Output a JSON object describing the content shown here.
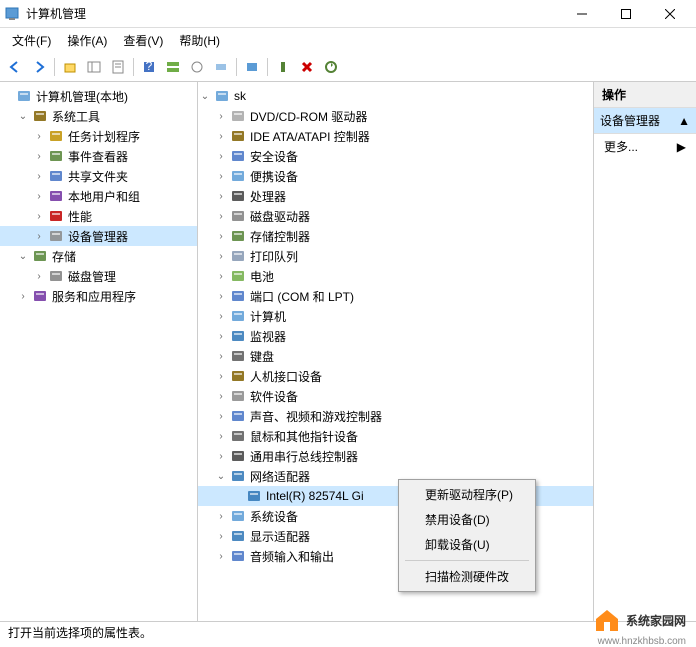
{
  "window": {
    "title": "计算机管理"
  },
  "menubar": [
    "文件(F)",
    "操作(A)",
    "查看(V)",
    "帮助(H)"
  ],
  "actions_panel": {
    "header": "操作",
    "selected": "设备管理器",
    "more": "更多..."
  },
  "statusbar": "打开当前选择项的属性表。",
  "left_tree": {
    "root": "计算机管理(本地)",
    "groups": [
      {
        "label": "系统工具",
        "expanded": true,
        "children": [
          {
            "label": "任务计划程序",
            "icon": "task"
          },
          {
            "label": "事件查看器",
            "icon": "event"
          },
          {
            "label": "共享文件夹",
            "icon": "share"
          },
          {
            "label": "本地用户和组",
            "icon": "users"
          },
          {
            "label": "性能",
            "icon": "perf"
          },
          {
            "label": "设备管理器",
            "icon": "device",
            "selected": true
          }
        ]
      },
      {
        "label": "存储",
        "expanded": true,
        "children": [
          {
            "label": "磁盘管理",
            "icon": "disk"
          }
        ]
      },
      {
        "label": "服务和应用程序",
        "expanded": false
      }
    ]
  },
  "device_tree": {
    "root": "sk",
    "categories": [
      {
        "label": "DVD/CD-ROM 驱动器",
        "icon": "disc"
      },
      {
        "label": "IDE ATA/ATAPI 控制器",
        "icon": "ide"
      },
      {
        "label": "安全设备",
        "icon": "security"
      },
      {
        "label": "便携设备",
        "icon": "portable"
      },
      {
        "label": "处理器",
        "icon": "cpu"
      },
      {
        "label": "磁盘驱动器",
        "icon": "disk"
      },
      {
        "label": "存储控制器",
        "icon": "storage"
      },
      {
        "label": "打印队列",
        "icon": "printer"
      },
      {
        "label": "电池",
        "icon": "battery"
      },
      {
        "label": "端口 (COM 和 LPT)",
        "icon": "port"
      },
      {
        "label": "计算机",
        "icon": "computer"
      },
      {
        "label": "监视器",
        "icon": "monitor"
      },
      {
        "label": "键盘",
        "icon": "keyboard"
      },
      {
        "label": "人机接口设备",
        "icon": "hid"
      },
      {
        "label": "软件设备",
        "icon": "software"
      },
      {
        "label": "声音、视频和游戏控制器",
        "icon": "sound"
      },
      {
        "label": "鼠标和其他指针设备",
        "icon": "mouse"
      },
      {
        "label": "通用串行总线控制器",
        "icon": "usb"
      },
      {
        "label": "网络适配器",
        "icon": "network",
        "expanded": true,
        "children": [
          {
            "label": "Intel(R) 82574L Gi",
            "icon": "nic",
            "selected": true
          }
        ]
      },
      {
        "label": "系统设备",
        "icon": "system"
      },
      {
        "label": "显示适配器",
        "icon": "display"
      },
      {
        "label": "音频输入和输出",
        "icon": "audio"
      }
    ]
  },
  "context_menu": [
    {
      "label": "更新驱动程序(P)"
    },
    {
      "label": "禁用设备(D)"
    },
    {
      "label": "卸载设备(U)"
    },
    {
      "sep": true
    },
    {
      "label": "扫描检测硬件改"
    }
  ],
  "watermark": {
    "text": "系统家园网",
    "url": "www.hnzkhbsb.com"
  }
}
